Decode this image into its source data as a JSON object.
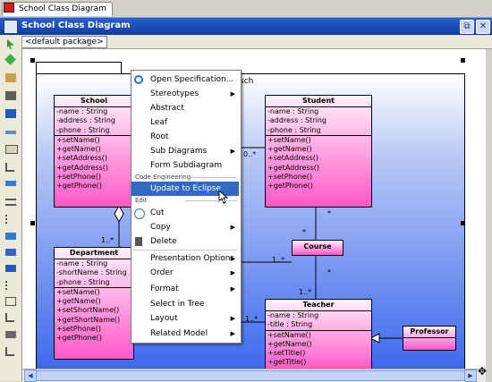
{
  "window_tab": {
    "label": "School Class Diagram"
  },
  "titlebar": {
    "title": "School Class Diagram",
    "restore_glyph": "⧉",
    "close_glyph": "✕"
  },
  "package_bar": {
    "current": "<default package>",
    "search_glyph": "⌕"
  },
  "diagram": {
    "package_name": "sch",
    "classes": [
      {
        "id": "school",
        "name": "School",
        "attributes": [
          "-name : String",
          "-address : String",
          "-phone : String"
        ],
        "operations": [
          "+setName()",
          "+getName()",
          "+setAddress()",
          "+getAddress()",
          "+setPhone()",
          "+getPhone()"
        ]
      },
      {
        "id": "student",
        "name": "Student",
        "attributes": [
          "-name : String",
          "-address : String",
          "-phone : String"
        ],
        "operations": [
          "+setName()",
          "+getName()",
          "+setAddress()",
          "+getAddress()",
          "+setPhone()",
          "+getPhone()"
        ]
      },
      {
        "id": "department",
        "name": "Department",
        "attributes": [
          "-name : String",
          "-shortName : String",
          "-phone : String"
        ],
        "operations": [
          "+setName()",
          "+getName()",
          "+setShortName()",
          "+getShortName()",
          "+setPhone()",
          "+getPhone()"
        ]
      },
      {
        "id": "course",
        "name": "Course",
        "attributes": [],
        "operations": []
      },
      {
        "id": "teacher",
        "name": "Teacher",
        "attributes": [
          "-name : String",
          "-title : String"
        ],
        "operations": [
          "+setName()",
          "+getName()",
          "+setTitle()",
          "+getTitle()"
        ]
      },
      {
        "id": "professor",
        "name": "Professor",
        "attributes": [],
        "operations": []
      }
    ],
    "multiplicities": {
      "school_student": "0..*",
      "school_department": "1..*",
      "student_course": "*",
      "student_course_b": "*",
      "department_course": "1..*",
      "course_teacher": "*",
      "course_teacher_b": "1..*",
      "department_teacher": "1..*"
    }
  },
  "context_menu": {
    "items_top": [
      {
        "label": "Open Specification...",
        "icon": "magnifier-icon",
        "submenu": false
      },
      {
        "label": "Stereotypes",
        "submenu": true
      },
      {
        "label": "Abstract",
        "submenu": false
      },
      {
        "label": "Leaf",
        "submenu": false
      },
      {
        "label": "Root",
        "submenu": false
      },
      {
        "label": "Sub Diagrams",
        "submenu": true
      },
      {
        "label": "Form Subdiagram",
        "submenu": false
      }
    ],
    "section_code": "Code Engineering",
    "update_item": "Update to Eclipse",
    "section_edit": "Edit",
    "items_edit": [
      {
        "label": "Cut",
        "icon": "scissors-icon",
        "submenu": false
      },
      {
        "label": "Copy",
        "submenu": true
      },
      {
        "label": "Delete",
        "icon": "trash-icon",
        "submenu": false
      }
    ],
    "items_bottom": [
      {
        "label": "Presentation Options",
        "submenu": true
      },
      {
        "label": "Order",
        "submenu": true
      },
      {
        "label": "Format",
        "submenu": true
      },
      {
        "label": "Select in Tree",
        "submenu": false
      },
      {
        "label": "Layout",
        "submenu": true
      },
      {
        "label": "Related Model",
        "submenu": true
      }
    ],
    "submenu_glyph": "▶"
  },
  "scroll": {
    "left_glyph": "◀",
    "right_glyph": "▶",
    "corner_glyph": "✥"
  }
}
